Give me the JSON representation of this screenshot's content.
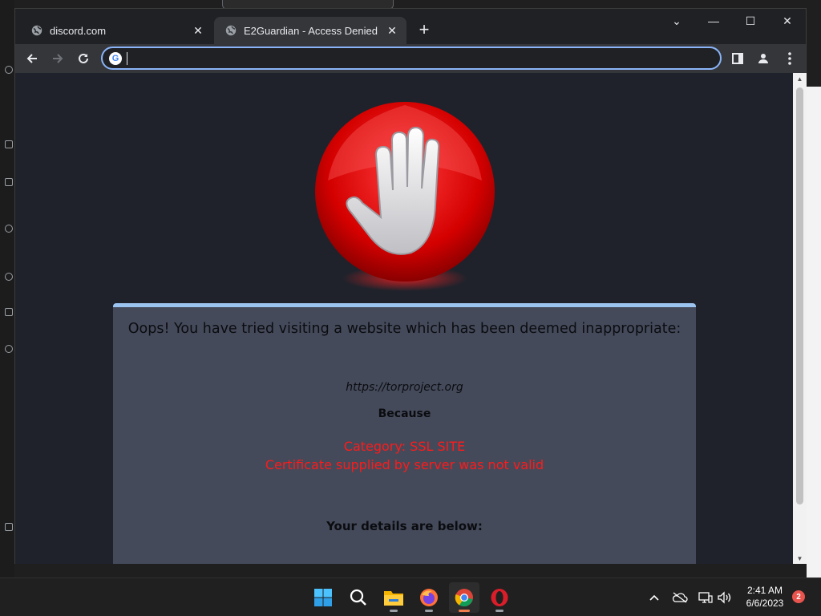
{
  "browser": {
    "tabs": [
      {
        "title": "discord.com",
        "active": false,
        "icon": "globe-icon"
      },
      {
        "title": "E2Guardian - Access Denied",
        "active": true,
        "icon": "globe-icon"
      }
    ],
    "new_tab_glyph": "+",
    "window_controls": {
      "tab_search": "⌄",
      "minimize": "—",
      "maximize": "☐",
      "close": "✕"
    },
    "omnibox": {
      "value": "",
      "search_engine_icon": "G"
    },
    "accent_color": "#8ab4f8"
  },
  "page": {
    "headline": "Oops! You have tried visiting a website which has been deemed inappropriate:",
    "blocked_url": "https://torproject.org",
    "because_label": "Because",
    "reason_lines": [
      "Category: SSL SITE",
      "Certificate supplied by server was not valid"
    ],
    "details_label": "Your details are below:",
    "reason_color": "#ff1a1a"
  },
  "taskbar": {
    "apps": [
      {
        "name": "start",
        "icon": "windows-start-icon"
      },
      {
        "name": "search",
        "icon": "search-icon"
      },
      {
        "name": "file-explorer",
        "icon": "folder-icon"
      },
      {
        "name": "firefox",
        "icon": "firefox-icon"
      },
      {
        "name": "chrome",
        "icon": "chrome-icon",
        "active": true
      },
      {
        "name": "opera",
        "icon": "opera-icon"
      }
    ],
    "clock": {
      "time": "2:41 AM",
      "date": "6/6/2023"
    },
    "notification_count": "2"
  }
}
